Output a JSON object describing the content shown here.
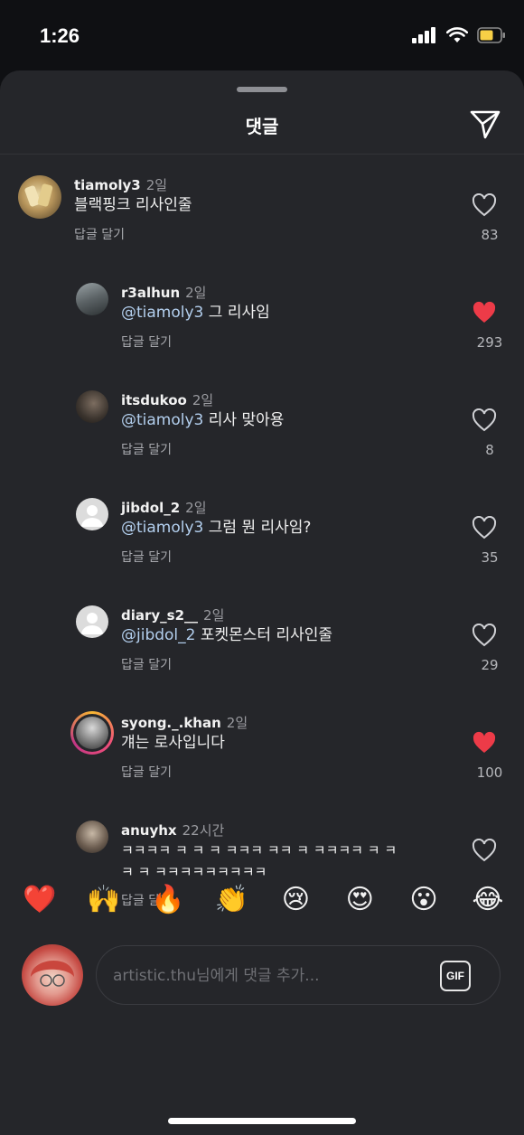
{
  "status_bar": {
    "time": "1:26"
  },
  "sheet": {
    "title": "댓글"
  },
  "comments": [
    {
      "username": "tiamoly3",
      "time": "2일",
      "mention": "",
      "text": "블랙핑크 리사인줄",
      "reply": "답글 달기",
      "likes": "83",
      "liked": false
    },
    {
      "username": "r3alhun",
      "time": "2일",
      "mention": "@tiamoly3",
      "text": " 그 리사임",
      "reply": "답글 달기",
      "likes": "293",
      "liked": true
    },
    {
      "username": "itsdukoo",
      "time": "2일",
      "mention": "@tiamoly3",
      "text": " 리사 맞아용",
      "reply": "답글 달기",
      "likes": "8",
      "liked": false
    },
    {
      "username": "jibdol_2",
      "time": "2일",
      "mention": "@tiamoly3",
      "text": " 그럼 뭔 리사임?",
      "reply": "답글 달기",
      "likes": "35",
      "liked": false
    },
    {
      "username": "diary_s2__",
      "time": "2일",
      "mention": "@jibdol_2",
      "text": " 포켓몬스터 리사인줄",
      "reply": "답글 달기",
      "likes": "29",
      "liked": false
    },
    {
      "username": "syong._.khan",
      "time": "2일",
      "mention": "",
      "text": "걔는 로사입니다",
      "reply": "답글 달기",
      "likes": "100",
      "liked": true
    },
    {
      "username": "anuyhx",
      "time": "22시간",
      "mention": "",
      "text_line1": "ㅋㅋㅋㅋ ㅋ ㅋ ㅋ ㅋㅋㅋ ㅋㅋ ㅋ ㅋㅋㅋㅋ ㅋ ㅋ",
      "text_line2": "ㅋ ㅋ ㅋㅋㅋㅋㅋㅋㅋㅋㅋ",
      "reply": "답글 달기",
      "likes": "",
      "liked": false
    }
  ],
  "reactions": [
    "❤️",
    "🙌",
    "🔥",
    "👏",
    "😢",
    "😍",
    "😮",
    "😂"
  ],
  "composer": {
    "placeholder": "artistic.thu님에게 댓글 추가...",
    "gif_label": "GIF"
  },
  "colors": {
    "sheet_bg": "#25262a",
    "mention": "#b3cfee",
    "like_red": "#ed3b48",
    "story_ring": "#f0507a"
  }
}
